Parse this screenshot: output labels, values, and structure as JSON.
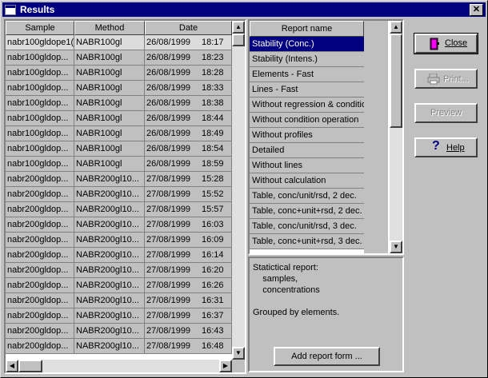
{
  "window": {
    "title": "Results",
    "close_glyph": "✕"
  },
  "samples": {
    "headers": [
      "Sample",
      "Method",
      "Date"
    ],
    "rows": [
      [
        "nabr100gldope1(",
        "NABR100gl",
        "26/08/1999",
        "18:17"
      ],
      [
        "nabr100gldop...",
        "NABR100gl",
        "26/08/1999",
        "18:23"
      ],
      [
        "nabr100gldop...",
        "NABR100gl",
        "26/08/1999",
        "18:28"
      ],
      [
        "nabr100gldop...",
        "NABR100gl",
        "26/08/1999",
        "18:33"
      ],
      [
        "nabr100gldop...",
        "NABR100gl",
        "26/08/1999",
        "18:38"
      ],
      [
        "nabr100gldop...",
        "NABR100gl",
        "26/08/1999",
        "18:44"
      ],
      [
        "nabr100gldop...",
        "NABR100gl",
        "26/08/1999",
        "18:49"
      ],
      [
        "nabr100gldop...",
        "NABR100gl",
        "26/08/1999",
        "18:54"
      ],
      [
        "nabr100gldop...",
        "NABR100gl",
        "26/08/1999",
        "18:59"
      ],
      [
        "nabr200gldop...",
        "NABR200gl10...",
        "27/08/1999",
        "15:28"
      ],
      [
        "nabr200gldop...",
        "NABR200gl10...",
        "27/08/1999",
        "15:52"
      ],
      [
        "nabr200gldop...",
        "NABR200gl10...",
        "27/08/1999",
        "15:57"
      ],
      [
        "nabr200gldop...",
        "NABR200gl10...",
        "27/08/1999",
        "16:03"
      ],
      [
        "nabr200gldop...",
        "NABR200gl10...",
        "27/08/1999",
        "16:09"
      ],
      [
        "nabr200gldop...",
        "NABR200gl10...",
        "27/08/1999",
        "16:14"
      ],
      [
        "nabr200gldop...",
        "NABR200gl10...",
        "27/08/1999",
        "16:20"
      ],
      [
        "nabr200gldop...",
        "NABR200gl10...",
        "27/08/1999",
        "16:26"
      ],
      [
        "nabr200gldop...",
        "NABR200gl10...",
        "27/08/1999",
        "16:31"
      ],
      [
        "nabr200gldop...",
        "NABR200gl10...",
        "27/08/1999",
        "16:37"
      ],
      [
        "nabr200gldop...",
        "NABR200gl10...",
        "27/08/1999",
        "16:43"
      ],
      [
        "nabr200gldop...",
        "NABR200gl10...",
        "27/08/1999",
        "16:48"
      ]
    ]
  },
  "reports": {
    "header": "Report name",
    "items": [
      "Stability (Conc.)",
      "Stability (Intens.)",
      "Elements - Fast",
      "Lines       - Fast",
      "Without regression & condition",
      "Without condition operation",
      "Without profiles",
      "Detailed",
      "Without lines",
      "Without calculation",
      "Table, conc/unit/rsd, 2 dec.",
      "Table, conc+unit+rsd, 2 dec.",
      "Table, conc/unit/rsd, 3 dec.",
      "Table, conc+unit+rsd, 3 dec."
    ],
    "selected_index": 0,
    "description": "Statictical report:\n    samples,\n    concentrations\n\nGrouped by elements.",
    "add_button": "Add report form ..."
  },
  "buttons": {
    "close": "Close",
    "print": "Print...",
    "preview": "Preview",
    "help": "Help"
  },
  "scroll_glyphs": {
    "up": "▲",
    "down": "▼",
    "left": "◀",
    "right": "▶"
  }
}
